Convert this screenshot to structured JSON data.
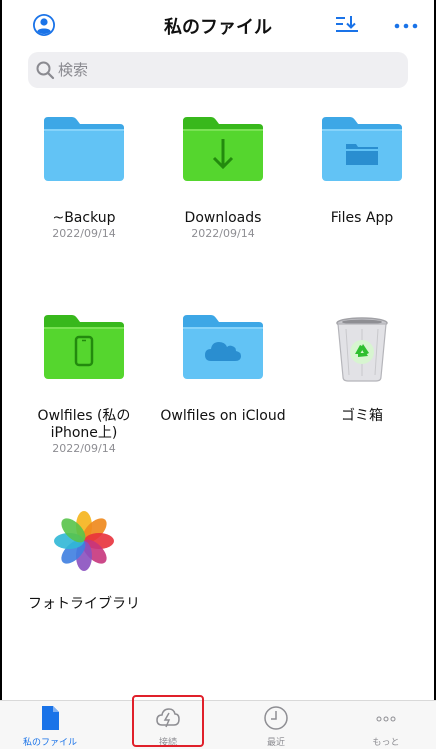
{
  "header": {
    "title": "私のファイル",
    "profile_icon": "person-circle-icon",
    "sort_icon": "sort-down-icon",
    "more_icon": "ellipsis-icon",
    "accent_color": "#1a73e8"
  },
  "search": {
    "placeholder": "検索"
  },
  "items": [
    {
      "name": "~Backup",
      "date": "2022/09/14",
      "icon": "blue-folder-icon"
    },
    {
      "name": "Downloads",
      "date": "2022/09/14",
      "icon": "green-download-folder-icon"
    },
    {
      "name": "Files App",
      "date": "",
      "icon": "blue-files-folder-icon"
    },
    {
      "name": "Owlfiles (私の\niPhone上)",
      "name_line1": "Owlfiles (私の",
      "name_line2": "iPhone上)",
      "date": "2022/09/14",
      "icon": "green-iphone-folder-icon"
    },
    {
      "name": "Owlfiles on iCloud",
      "date": "",
      "icon": "blue-cloud-folder-icon"
    },
    {
      "name": "ゴミ箱",
      "date": "",
      "icon": "trash-bin-icon"
    },
    {
      "name": "フォトライブラリ",
      "date": "",
      "icon": "photos-flower-icon"
    }
  ],
  "tabs": [
    {
      "label": "私のファイル",
      "icon": "document-icon",
      "active": true
    },
    {
      "label": "接続",
      "icon": "cloud-bolt-icon",
      "active": false,
      "highlighted": true
    },
    {
      "label": "最近",
      "icon": "clock-icon",
      "active": false
    },
    {
      "label": "もっと",
      "icon": "dots-icon",
      "active": false
    }
  ]
}
